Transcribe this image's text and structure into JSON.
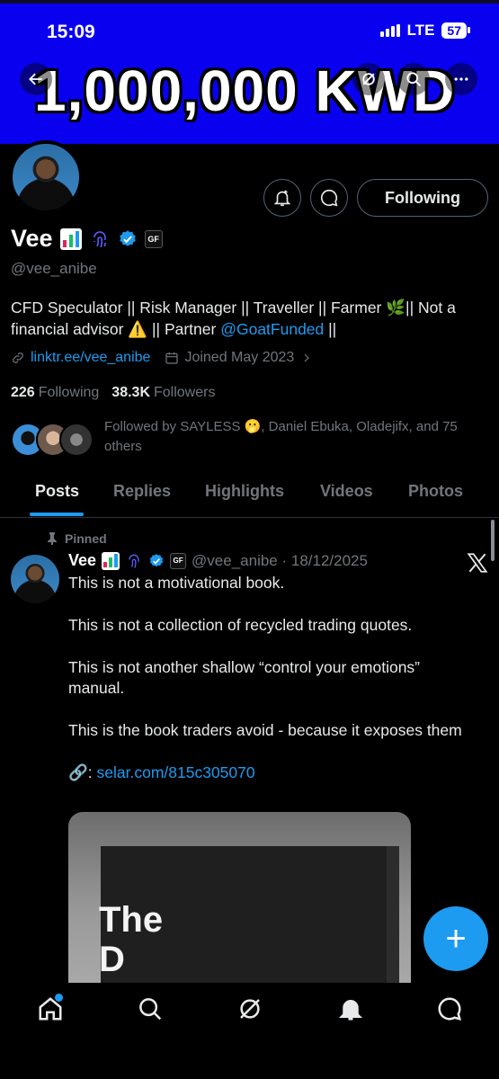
{
  "status_bar": {
    "time": "15:09",
    "network": "LTE",
    "battery": "57"
  },
  "banner": {
    "text": "1,000,000 KWD",
    "color": "#0a00f0"
  },
  "header_icons": [
    "back-arrow-icon",
    "grok-icon",
    "search-icon",
    "more-icon"
  ],
  "profile": {
    "name": "Vee",
    "handle": "@vee_anibe",
    "bio_part1": "CFD Speculator || Risk Manager || Traveller || Farmer 🌿|| Not a financial advisor ⚠️ || Partner ",
    "bio_mention": "@GoatFunded",
    "bio_part2": " ||",
    "website": "linktr.ee/vee_anibe",
    "joined": "Joined May 2023",
    "following_count": "226",
    "following_label": "Following",
    "followers_count": "38.3K",
    "followers_label": "Followers",
    "followed_by": "Followed by SAYLESS 🫢, Daniel Ebuka, Oladejifx, and 75 others",
    "affiliate_badge": "GF"
  },
  "actions": {
    "following_button": "Following"
  },
  "tabs": [
    "Posts",
    "Replies",
    "Highlights",
    "Videos",
    "Photos"
  ],
  "post": {
    "pinned_label": "Pinned",
    "name": "Vee",
    "handle_date": "@vee_anibe · 18/12/2025",
    "lines": [
      "This is not a motivational book.",
      "This is not a collection of recycled trading quotes.",
      "This is not another shallow “control your emotions” manual.",
      "This is the book traders avoid - because it exposes them"
    ],
    "link_prefix": "🔗: ",
    "link": "selar.com/815c305070",
    "image_title_1": "The",
    "image_title_2": "D"
  },
  "fab": {
    "label": "+"
  },
  "bottom_nav": [
    "home-icon",
    "search-icon",
    "grok-icon",
    "notifications-icon",
    "messages-icon"
  ],
  "colors": {
    "accent": "#1d9bf0",
    "muted": "#71767b",
    "text": "#e7e9ea",
    "background": "#000000"
  }
}
